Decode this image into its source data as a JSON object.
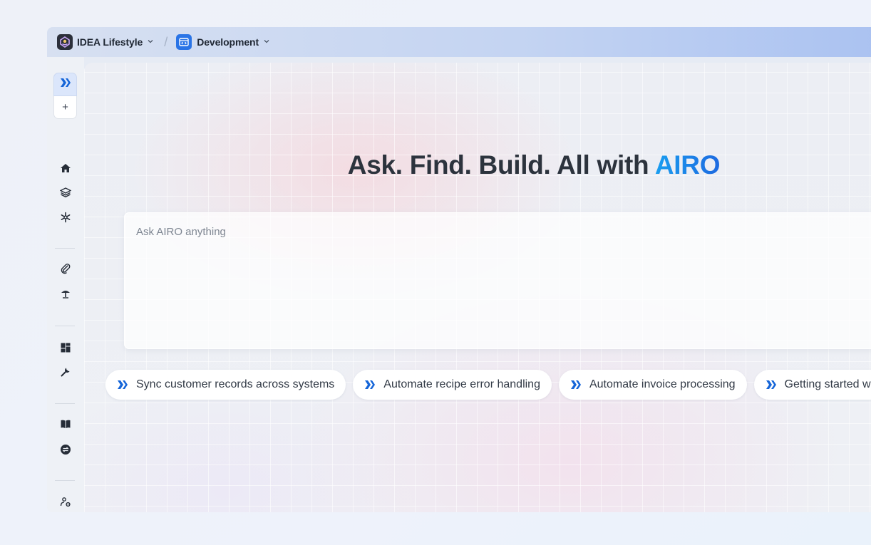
{
  "breadcrumb": {
    "workspace": {
      "label": "IDEA Lifestyle",
      "icon": "workspace-logo-icon"
    },
    "separator": "/",
    "environment": {
      "label": "Development",
      "icon": "code-window-icon"
    }
  },
  "sidebar": {
    "expand_icon": "airo-chevrons-icon",
    "new_label": "+",
    "groups": [
      [
        "home-icon",
        "layers-icon",
        "snowflake-icon"
      ],
      [
        "paperclip-icon",
        "broom-icon"
      ],
      [
        "dashboard-icon",
        "wrench-icon"
      ],
      [
        "book-icon",
        "swap-icon"
      ],
      [
        "user-settings-icon",
        "building-settings-icon"
      ]
    ]
  },
  "main": {
    "headline": "Ask. Find. Build. All with",
    "headline_brand": "AIRO",
    "prompt_placeholder": "Ask AIRO anything",
    "suggestions": [
      "Sync customer records across systems",
      "Automate recipe error handling",
      "Automate invoice processing",
      "Getting started with"
    ]
  },
  "colors": {
    "accent": "#1565d8",
    "brand_gradient_start": "#1a9ef0",
    "brand_gradient_end": "#1d6ae0",
    "text": "#2c333d"
  }
}
